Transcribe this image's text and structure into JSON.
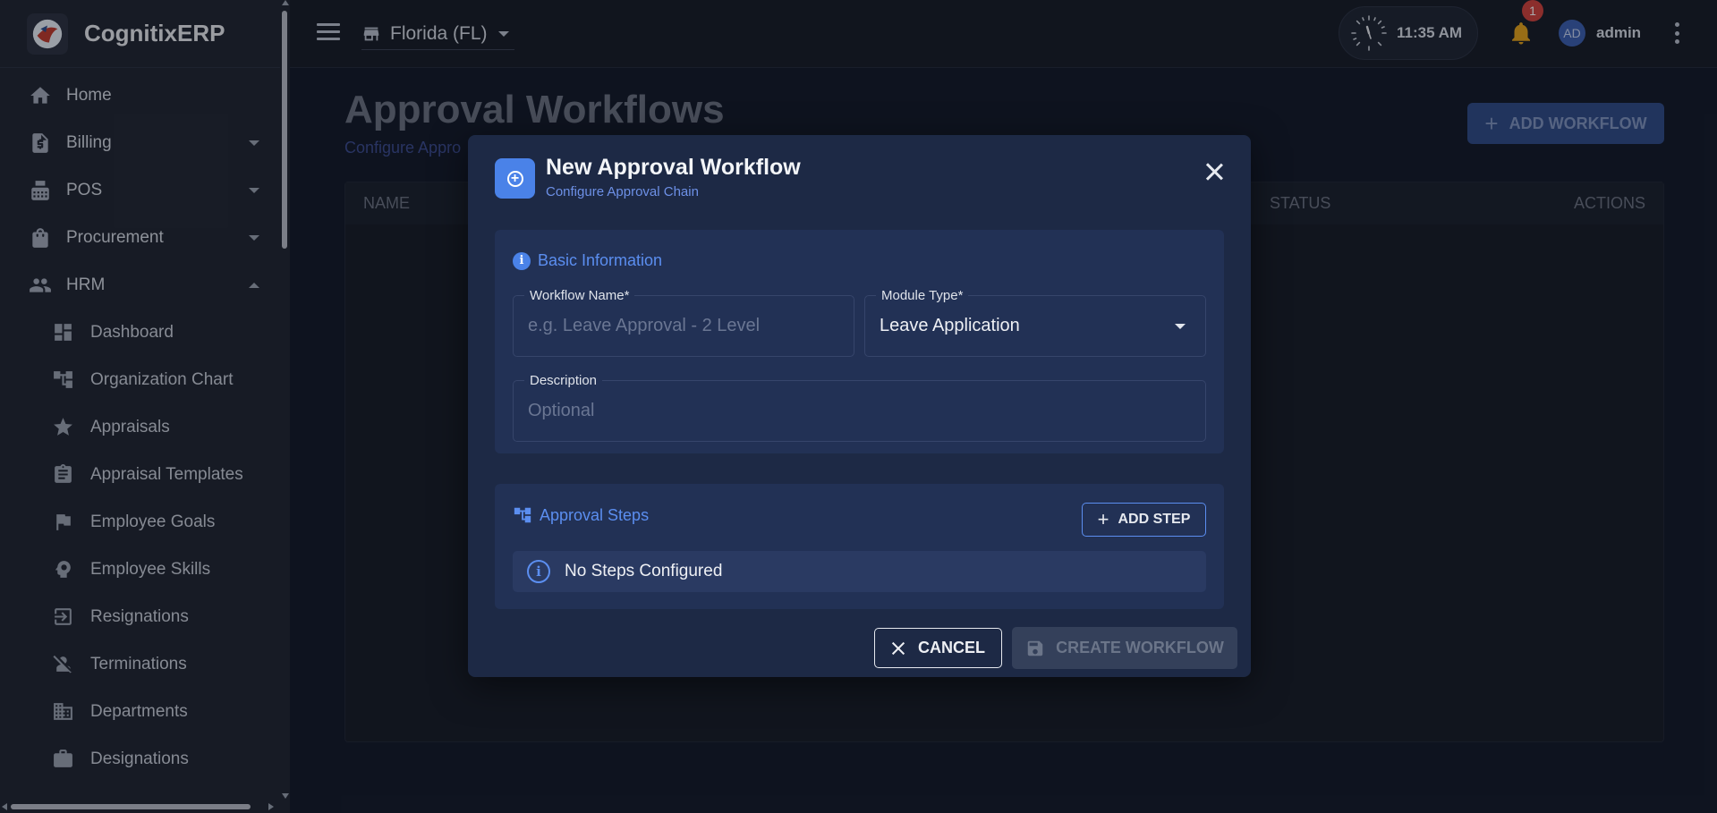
{
  "app": {
    "name": "CognitixERP"
  },
  "sidebar": {
    "items": [
      {
        "label": "Home",
        "icon": "home-icon"
      },
      {
        "label": "Billing",
        "icon": "billing-icon",
        "expanded": false
      },
      {
        "label": "POS",
        "icon": "pos-icon",
        "expanded": false
      },
      {
        "label": "Procurement",
        "icon": "shopping-bag-icon",
        "expanded": false
      },
      {
        "label": "HRM",
        "icon": "people-icon",
        "expanded": true
      }
    ],
    "hrm_items": [
      {
        "label": "Dashboard",
        "icon": "dashboard-icon"
      },
      {
        "label": "Organization Chart",
        "icon": "org-chart-icon"
      },
      {
        "label": "Appraisals",
        "icon": "star-icon"
      },
      {
        "label": "Appraisal Templates",
        "icon": "clipboard-icon"
      },
      {
        "label": "Employee Goals",
        "icon": "flag-icon"
      },
      {
        "label": "Employee Skills",
        "icon": "psychology-icon"
      },
      {
        "label": "Resignations",
        "icon": "exit-icon"
      },
      {
        "label": "Terminations",
        "icon": "person-off-icon"
      },
      {
        "label": "Departments",
        "icon": "building-icon"
      },
      {
        "label": "Designations",
        "icon": "briefcase-icon"
      }
    ]
  },
  "topbar": {
    "store": "Florida (FL)",
    "time": "11:35 AM",
    "notifications": "1",
    "avatar_initials": "AD",
    "username": "admin"
  },
  "page": {
    "title": "Approval Workflows",
    "subtitle": "Configure Appro",
    "add_button": "ADD WORKFLOW",
    "table_headers": {
      "name": "NAME",
      "status": "STATUS",
      "actions": "ACTIONS"
    }
  },
  "modal": {
    "title": "New Approval Workflow",
    "subtitle": "Configure Approval Chain",
    "basic_info": {
      "heading": "Basic Information",
      "workflow_name": {
        "label": "Workflow Name*",
        "placeholder": "e.g. Leave Approval - 2 Level",
        "value": ""
      },
      "module_type": {
        "label": "Module Type*",
        "value": "Leave Application"
      },
      "description": {
        "label": "Description",
        "placeholder": "Optional",
        "value": ""
      }
    },
    "steps": {
      "heading": "Approval Steps",
      "add_label": "ADD STEP",
      "empty_text": "No Steps Configured"
    },
    "cancel_label": "CANCEL",
    "create_label": "CREATE WORKFLOW"
  },
  "colors": {
    "accent": "#4a82e8",
    "modal_bg": "#1d2945",
    "badge": "#d1413b",
    "bell": "#e5a11a"
  }
}
